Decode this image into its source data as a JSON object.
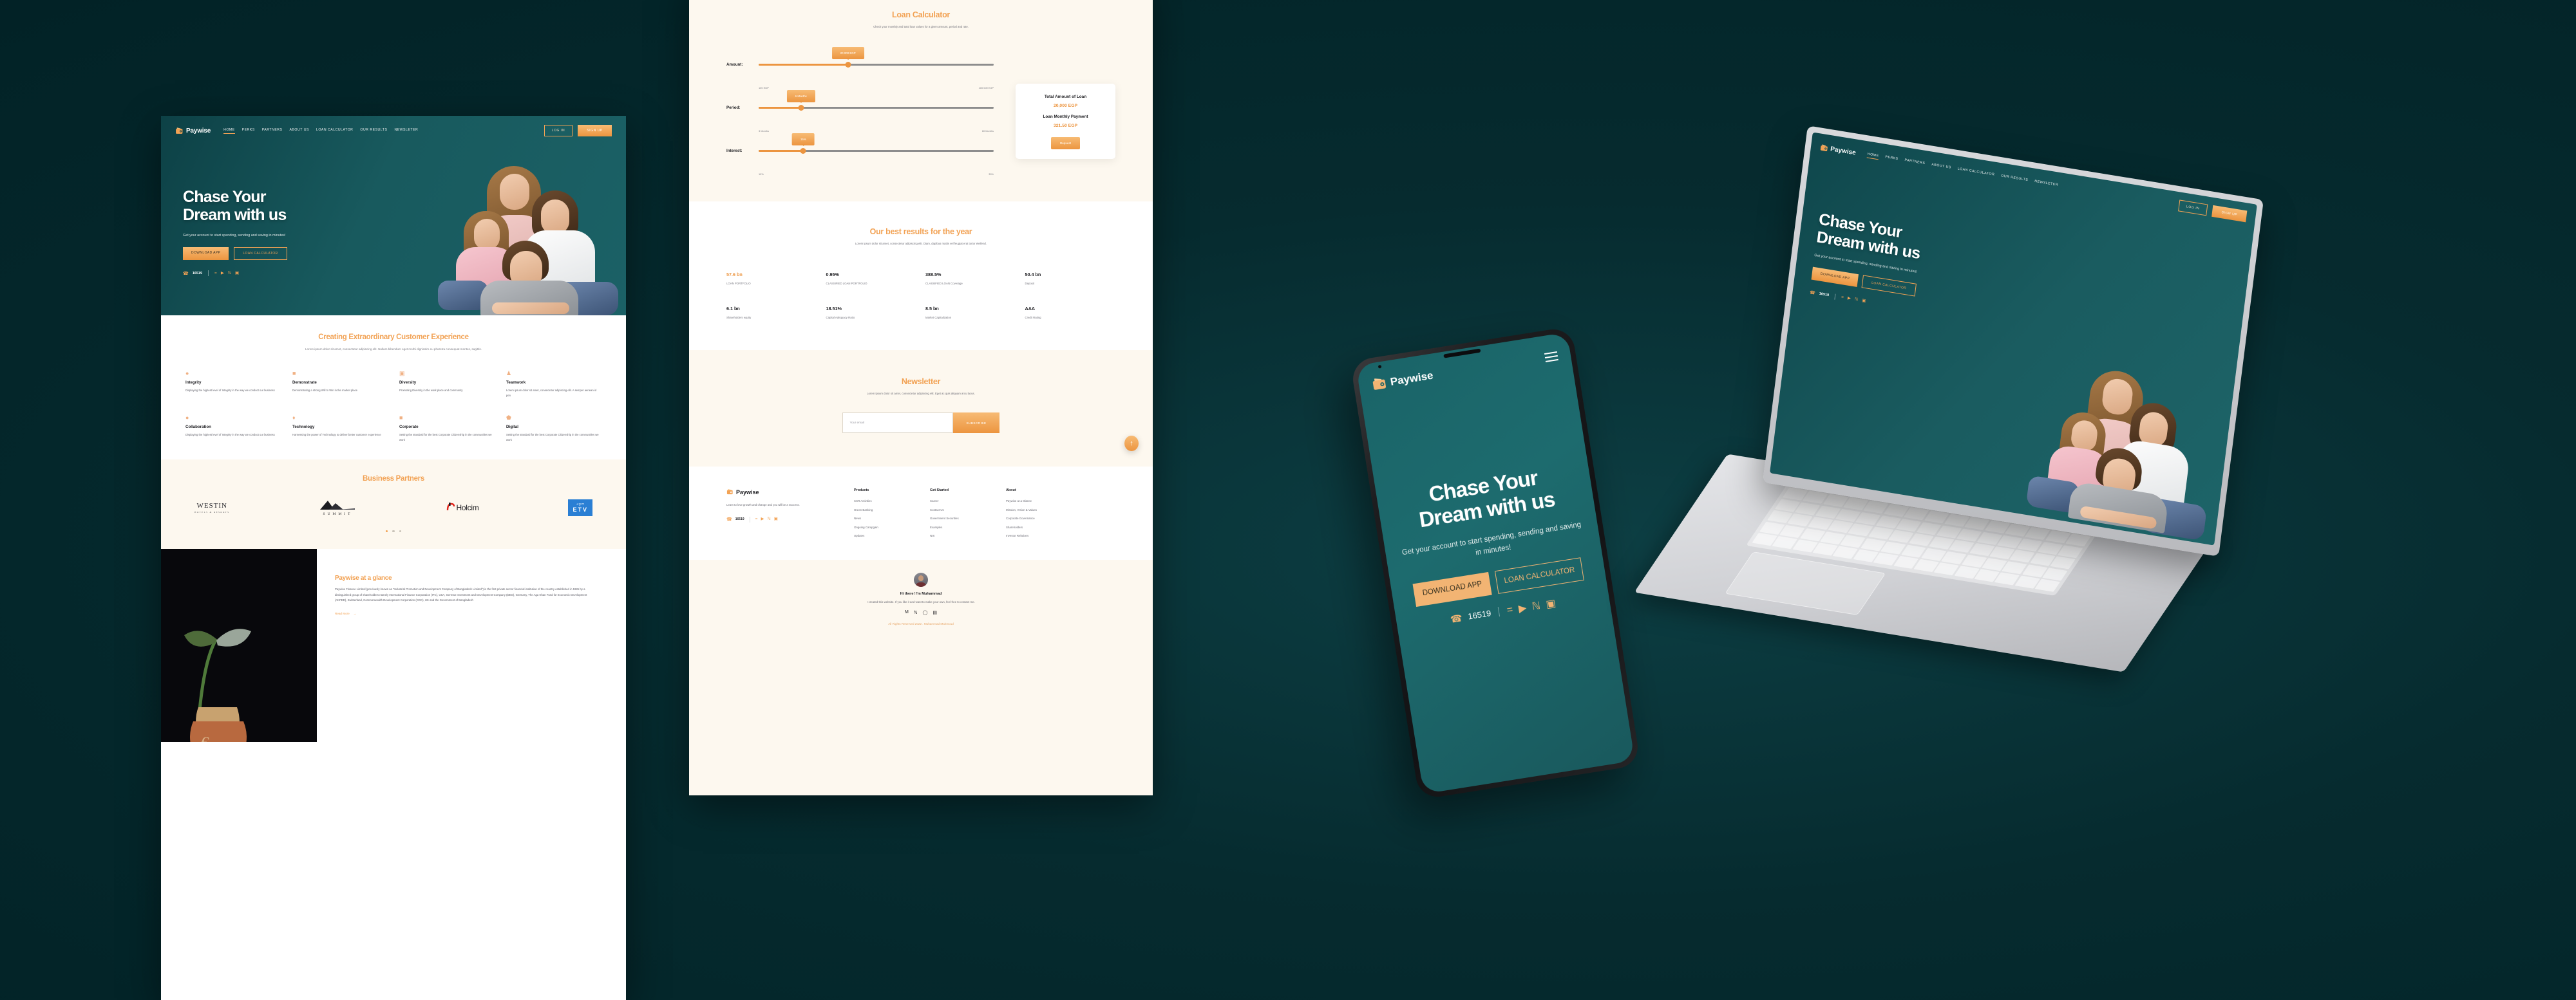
{
  "brand": {
    "name": "Paywise",
    "accent": "#F2A254",
    "teal": "#12555A",
    "bg_dark": "#052A2E"
  },
  "desktop": {
    "nav": {
      "items": [
        "HOME",
        "PERKS",
        "PARTNERS",
        "ABOUT US",
        "LOAN CALCULATOR",
        "OUR RESULTS",
        "NEWSLETER"
      ],
      "active": "HOME",
      "login_label": "LOG IN",
      "signup_label": "SIGN UP"
    },
    "hero": {
      "title_line1": "Chase Your",
      "title_line2": "Dream with us",
      "subtitle": "Get your account to start spending, sending and saving in minutes!",
      "cta_primary": "DOWNLOAD APP",
      "cta_secondary": "LOAN CALCULATOR",
      "phone": "16519",
      "socials": [
        "facebook",
        "youtube",
        "linkedin",
        "instagram"
      ]
    },
    "values": {
      "title": "Creating Extraordinary Customer Experience",
      "subtitle": "Lorem ipsum dolor sit amet, consectetur adipiscing elit. Nullam bibendum eget morbi dignissim eu pharetra consequat montes, sagittis.",
      "items": [
        {
          "icon": "paint-drop-icon",
          "glyph": "◖",
          "name": "Integrity",
          "desc": "Displaying the highest level of Integrity in the way we conduct our business"
        },
        {
          "icon": "image-icon",
          "glyph": "ὛB",
          "name": "Demonstrate",
          "desc": "Demonstrating a strong Will to Win in the market place"
        },
        {
          "icon": "transform-icon",
          "glyph": "⧉",
          "name": "Diversity",
          "desc": "Promoting Diversity in the work place and community"
        },
        {
          "icon": "people-icon",
          "glyph": "὆5",
          "name": "Teamwork",
          "desc": "Lorem ipsum dolor sit amet, consectetur adipiscing elit. A semper aenean id pen"
        },
        {
          "icon": "paint-drop-icon",
          "glyph": "◖",
          "name": "Collaboration",
          "desc": "Displaying the highest level of Integrity in the way we conduct our business"
        },
        {
          "icon": "tag-icon",
          "glyph": "Ἷ7",
          "name": "Technology",
          "desc": "Harnessing the power of Technology to deliver better customer experience"
        },
        {
          "icon": "briefcase-icon",
          "glyph": "ὋC",
          "name": "Corporate",
          "desc": "Setting the standard for the best Corporate Citizenship in the communities we work"
        },
        {
          "icon": "box-icon",
          "glyph": "⬟",
          "name": "Digital",
          "desc": "Setting the standard for the best Corporate Citizenship in the communities we work"
        }
      ]
    },
    "partners": {
      "title": "Business Partners",
      "logos": [
        {
          "name": "WESTIN",
          "sub": "HOTELS & RESORTS"
        },
        {
          "name": "SUMMIT",
          "sub": ""
        },
        {
          "name": "Holcim",
          "sub": ""
        },
        {
          "name": "ETV",
          "sub": ""
        }
      ],
      "carousel_dots": 3,
      "active_dot": 1
    },
    "glance": {
      "title": "Paywise at a glance",
      "body": "Paywise Finance Limited (previously known as \"Industrial Promotion and Development Company of Bangladesh Limited\") is the first private sector financial institution of the country established in 1981 by a distinguished group of shareholders namely International Finance Corporation (IFC), USA, German Investment and Development Company (DEG), Germany, The Aga Khan Fund for Economic Development (AKFED), Switzerland, Commonwealth Development Corporation (CDC), UK and the Government of Bangladesh",
      "read_more": "Read More"
    }
  },
  "center": {
    "calculator": {
      "title": "Loan Calculator",
      "subtitle": "Check your monthly and total loan values for a given amount, period and rate.",
      "rows": [
        {
          "label": "Amount:",
          "bubble": "20 000 EGP",
          "min": "100 EGP",
          "max": "100 000 EGP",
          "pct": 38
        },
        {
          "label": "Period:",
          "bubble": "6 Months",
          "min": "3 Months",
          "max": "60 Months",
          "pct": 18
        },
        {
          "label": "Interest:",
          "bubble": "15%",
          "min": "10%",
          "max": "30%",
          "pct": 19
        }
      ],
      "result": {
        "total_label": "Total Amount of Loan",
        "total_value": "20,000 EGP",
        "monthly_label": "Loan Monthly Payment",
        "monthly_value": "321.50 EGP",
        "button": "Request"
      }
    },
    "results": {
      "title": "Our best results for the year",
      "subtitle": "Lorem ipsum dolor sit amet, consectetur adipiscing elit. Diam, dapibus mattis vel feugiat erat tortor eleifend.",
      "stats": [
        {
          "value": "57.6 bn",
          "label": "LOAN PORTFOLIO",
          "highlight": true
        },
        {
          "value": "0.95%",
          "label": "CLASSIFIED LOAN PORTFOLIO",
          "highlight": false
        },
        {
          "value": "388.5%",
          "label": "CLASSIFIED LOAN Coverage",
          "highlight": false
        },
        {
          "value": "50.4 bn",
          "label": "Deposit",
          "highlight": false
        },
        {
          "value": "6.1 bn",
          "label": "Shareholders equity",
          "highlight": false
        },
        {
          "value": "18.51%",
          "label": "Capital Adequacy Ratio",
          "highlight": false
        },
        {
          "value": "8.5 bn",
          "label": "Market Capitalization",
          "highlight": false
        },
        {
          "value": "AAA",
          "label": "Credit Rating",
          "highlight": false
        }
      ]
    },
    "newsletter": {
      "title": "Newsletter",
      "subtitle": "Lorem ipsum dolor sit amet, consectetur adipiscing elit. Eget ac quis aliquam arcu lacus.",
      "email_placeholder": "Your email",
      "subscribe_label": "SUBSCRIBE",
      "to_top": "↑"
    },
    "footer": {
      "brand": "Paywise",
      "tagline": "Learn to love growth and change and you will be a success.",
      "phone": "16519",
      "socials": [
        "facebook",
        "youtube",
        "linkedin",
        "instagram"
      ],
      "columns": [
        {
          "heading": "Products",
          "links": [
            "CSR Activities",
            "Green Banking",
            "News",
            "Ongoing Campgain",
            "Updates"
          ]
        },
        {
          "heading": "Get Started",
          "links": [
            "Career",
            "Contact Us",
            "Government Securities",
            "Examples",
            "NIS"
          ]
        },
        {
          "heading": "About",
          "links": [
            "Paywise at a Glance",
            "Mission, VIsion & Values",
            "Corporate Governance",
            "Shareholders",
            "Investor Relations"
          ]
        }
      ]
    },
    "credit": {
      "heading": "Hi there! I'm Muhammad",
      "body": "I created this website. If you like it and want to make your own, feel free to contact me.",
      "icons": [
        "gmail-icon",
        "linkedin-icon",
        "github-icon",
        "behance-icon"
      ],
      "rights": "All Rights Reserved 2022 . Muhammad Mahmoud"
    }
  },
  "phone": {
    "brand": "Paywise",
    "menu_icon": "hamburger-icon",
    "title_line1": "Chase Your",
    "title_line2": "Dream with us",
    "subtitle": "Get your account to start spending, sending and saving in minutes!",
    "cta_primary": "DOWNLOAD APP",
    "cta_secondary": "LOAN CALCULATOR",
    "phone_number": "16519",
    "socials": [
      "facebook",
      "youtube",
      "linkedin",
      "instagram"
    ]
  },
  "laptop": {
    "brand": "Paywise",
    "nav_items": [
      "HOME",
      "PERKS",
      "PARTNERS",
      "ABOUT US",
      "LOAN CALCULATOR",
      "OUR RESULTS",
      "NEWSLETER"
    ],
    "active": "HOME",
    "login_label": "LOG IN",
    "signup_label": "SIGN UP",
    "title_line1": "Chase Your",
    "title_line2": "Dream with us",
    "subtitle": "Get your account to start spending, sending and saving in minutes!",
    "cta_primary": "DOWNLOAD APP",
    "cta_secondary": "LOAN CALCULATOR",
    "phone_number": "16519"
  }
}
